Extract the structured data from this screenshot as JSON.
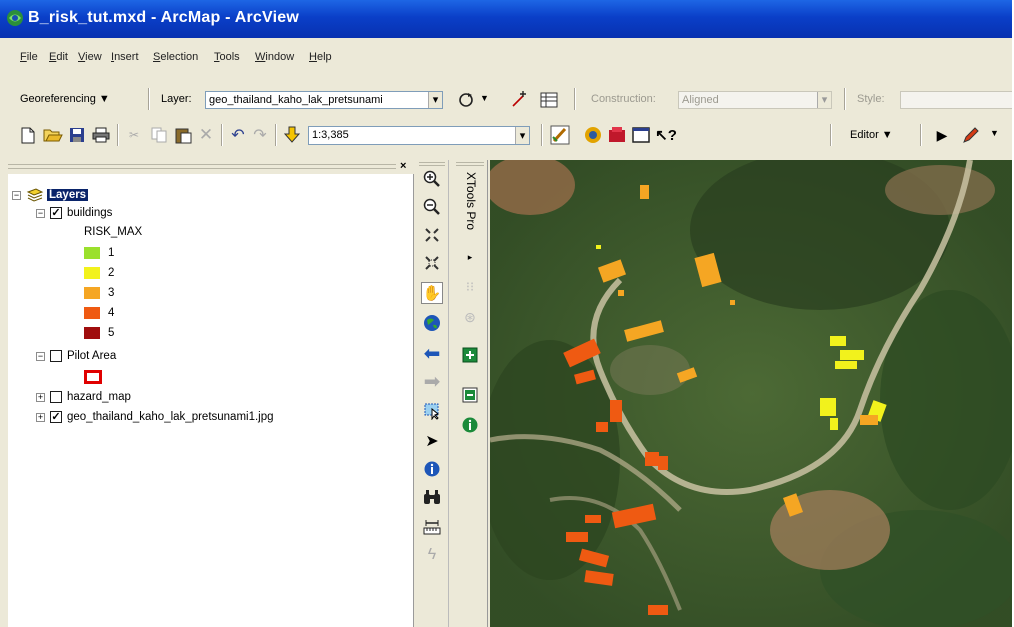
{
  "window": {
    "title": "B_risk_tut.mxd - ArcMap - ArcView"
  },
  "menu": [
    "File",
    "Edit",
    "View",
    "Insert",
    "Selection",
    "Tools",
    "Window",
    "Help"
  ],
  "georef_toolbar": {
    "georef_label": "Georeferencing ▼",
    "layer_label": "Layer:",
    "layer_value": "geo_thailand_kaho_lak_pretsunami",
    "construction_label": "Construction:",
    "construction_value": "Aligned",
    "style_label": "Style:"
  },
  "standard_toolbar": {
    "scale_value": "1:3,385",
    "editor_label": "Editor ▼"
  },
  "toc": {
    "close": "×",
    "root": "Layers",
    "buildings": "buildings",
    "field": "RISK_MAX",
    "classes": [
      {
        "label": "1",
        "color": "#9be02c"
      },
      {
        "label": "2",
        "color": "#f2f21c"
      },
      {
        "label": "3",
        "color": "#f5a623"
      },
      {
        "label": "4",
        "color": "#ef5a12"
      },
      {
        "label": "5",
        "color": "#a00d0d"
      }
    ],
    "pilot_area": "Pilot Area",
    "pilot_symbol_color": "#e00000",
    "hazard_map": "hazard_map",
    "image_layer": "geo_thailand_kaho_lak_pretsunami1.jpg"
  },
  "xtools": {
    "title": "XTools Pro"
  },
  "icons": {
    "zoom_in": "zoom-in-icon",
    "zoom_out": "zoom-out-icon",
    "fixed_zoom_in": "fixed-zoom-in-icon",
    "fixed_zoom_out": "fixed-zoom-out-icon",
    "pan": "pan-hand-icon",
    "full_extent": "globe-icon",
    "back": "back-arrow-icon",
    "forward": "forward-arrow-icon",
    "select": "select-features-icon",
    "pointer": "pointer-icon",
    "identify": "identify-icon",
    "find": "binoculars-icon",
    "measure": "measure-icon",
    "hyperlink": "lightning-icon"
  }
}
